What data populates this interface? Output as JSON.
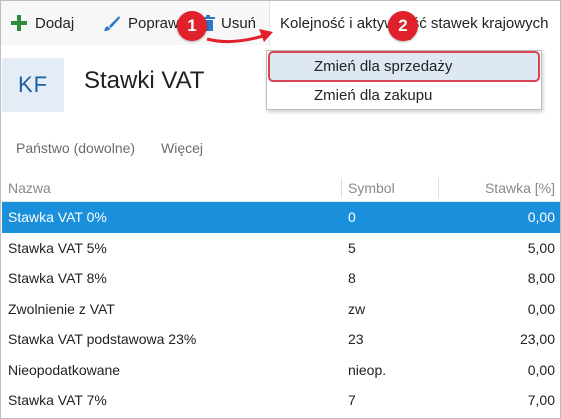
{
  "toolbar": {
    "add_label": "Dodaj",
    "edit_label": "Popraw",
    "delete_label": "Usuń",
    "order_label": "Kolejność i aktywność stawek krajowych"
  },
  "header": {
    "tile_text": "KF",
    "title": "Stawki VAT"
  },
  "filters": {
    "country": "Państwo (dowolne)",
    "more": "Więcej"
  },
  "table": {
    "columns": {
      "name": "Nazwa",
      "symbol": "Symbol",
      "rate": "Stawka [%]"
    },
    "rows": [
      {
        "name": "Stawka VAT 0%",
        "symbol": "0",
        "rate": "0,00"
      },
      {
        "name": "Stawka VAT 5%",
        "symbol": "5",
        "rate": "5,00"
      },
      {
        "name": "Stawka VAT 8%",
        "symbol": "8",
        "rate": "8,00"
      },
      {
        "name": "Zwolnienie z VAT",
        "symbol": "zw",
        "rate": "0,00"
      },
      {
        "name": "Stawka VAT podstawowa 23%",
        "symbol": "23",
        "rate": "23,00"
      },
      {
        "name": "Nieopodatkowane",
        "symbol": "nieop.",
        "rate": "0,00"
      },
      {
        "name": "Stawka VAT 7%",
        "symbol": "7",
        "rate": "7,00"
      }
    ],
    "selected_row": 0
  },
  "menu": {
    "items": [
      {
        "label": "Zmień dla sprzedaży"
      },
      {
        "label": "Zmień dla zakupu"
      }
    ]
  },
  "annotations": {
    "badge_1": "1",
    "badge_2": "2"
  },
  "colors": {
    "accent": "#1a8fdc",
    "add_icon": "#2e8b3a",
    "annotation_red": "#e0202a",
    "tile_text": "#1e5fa3"
  },
  "icons": {
    "add": "plus-icon",
    "edit": "brush-icon",
    "delete": "trash-icon",
    "caret": "chevron-down-icon"
  }
}
